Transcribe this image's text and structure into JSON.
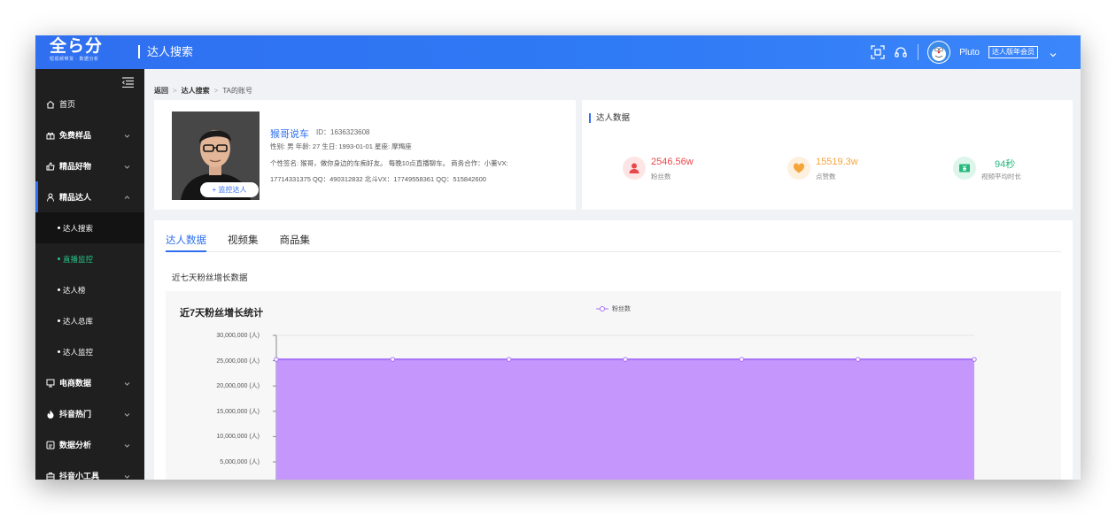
{
  "header": {
    "logo_main": "全ら分",
    "logo_sub": "短视频带货 · 数据分析",
    "page_title": "达人搜索",
    "username": "Pluto",
    "member_badge": "达人版年会员"
  },
  "sidebar": {
    "items": [
      {
        "icon": "home-icon",
        "label": "首页",
        "expandable": false
      },
      {
        "icon": "gift-icon",
        "label": "免费样品",
        "expandable": true
      },
      {
        "icon": "thumb-up-icon",
        "label": "精品好物",
        "expandable": true
      },
      {
        "icon": "person-icon",
        "label": "精品达人",
        "expandable": true,
        "expanded": true
      },
      {
        "icon": "monitor-icon",
        "label": "电商数据",
        "expandable": true
      },
      {
        "icon": "fire-icon",
        "label": "抖音热门",
        "expandable": true
      },
      {
        "icon": "analysis-icon",
        "label": "数据分析",
        "expandable": true
      },
      {
        "icon": "toolbox-icon",
        "label": "抖音小工具",
        "expandable": true
      }
    ],
    "subitems": [
      {
        "label": "达人搜索",
        "selected": true
      },
      {
        "label": "直播监控",
        "highlight": true
      },
      {
        "label": "达人榜"
      },
      {
        "label": "达人总库"
      },
      {
        "label": "达人监控"
      }
    ]
  },
  "breadcrumb": [
    "返回",
    "达人搜索",
    "TA的账号"
  ],
  "profile": {
    "name": "猴哥说车",
    "id": "ID：1636323608",
    "line1": "性别: 男   年龄: 27   生日: 1993-01-01   星座: 摩羯座",
    "line2": "个性签名: 猴哥，做你身边的车痴好友。 每晚10点直播聊车。 商务合作：小董VX:",
    "line3": "17714331375 QQ：490312832 北斗VX：17749558361 QQ：515842600",
    "monitor_button": "+ 监控达人"
  },
  "stats": {
    "title": "达人数据",
    "items": [
      {
        "icon": "fans-icon",
        "value": "2546.56w",
        "label": "粉丝数",
        "color": "#e8484a",
        "bg": "#fde5e5"
      },
      {
        "icon": "heart-icon",
        "value": "15519.3w",
        "label": "点赞数",
        "color": "#f5a63b",
        "bg": "#fdf0de"
      },
      {
        "icon": "money-icon",
        "value": "94秒",
        "label": "视频平均时长",
        "color": "#28b87e",
        "bg": "#ddf5ea"
      }
    ]
  },
  "tabs": [
    {
      "label": "达人数据",
      "active": true
    },
    {
      "label": "视频集",
      "active": false
    },
    {
      "label": "商品集",
      "active": false
    }
  ],
  "section_title": "近七天粉丝增长数据",
  "chart_data": {
    "type": "area",
    "title": "近7天粉丝增长统计",
    "series": [
      {
        "name": "粉丝数",
        "values": [
          25250000,
          25250000,
          25250000,
          25250000,
          25250000,
          25250000,
          25250000
        ],
        "color": "#a873f7"
      }
    ],
    "ylim": [
      0,
      30000000
    ],
    "y_ticks": [
      {
        "value": 30000000,
        "label": "30,000,000 (人)"
      },
      {
        "value": 25000000,
        "label": "25,000,000 (人)"
      },
      {
        "value": 20000000,
        "label": "20,000,000 (人)"
      },
      {
        "value": 15000000,
        "label": "15,000,000 (人)"
      },
      {
        "value": 10000000,
        "label": "10,000,000 (人)"
      },
      {
        "value": 5000000,
        "label": "5,000,000 (人)"
      }
    ],
    "grid": true,
    "legend": "top-center"
  }
}
